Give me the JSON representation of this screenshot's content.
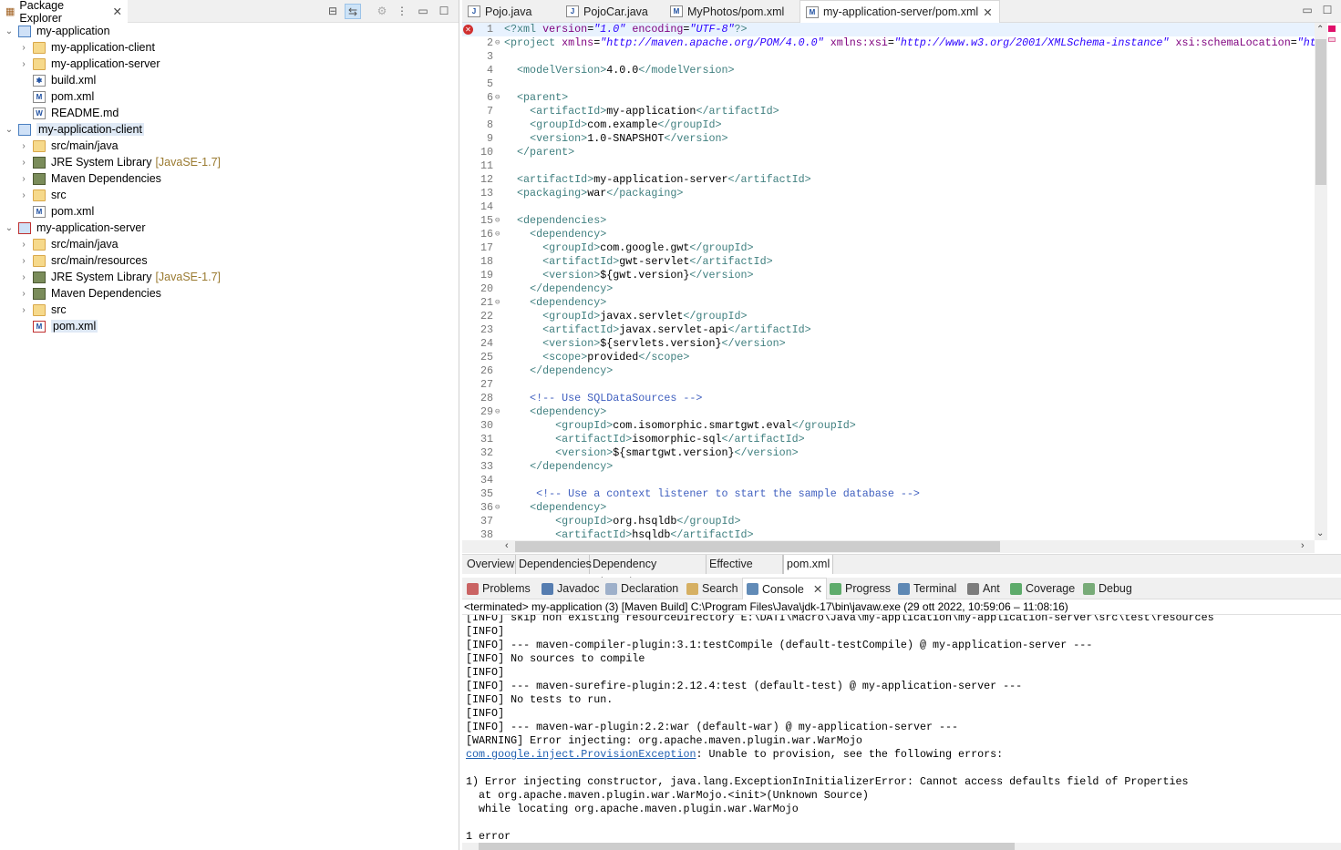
{
  "package_explorer": {
    "title": "Package Explorer",
    "tree": [
      {
        "level": 0,
        "expanded": true,
        "icon": "project",
        "label": "my-application"
      },
      {
        "level": 1,
        "expanded": false,
        "icon": "folder",
        "label": "my-application-client"
      },
      {
        "level": 1,
        "expanded": false,
        "icon": "folder",
        "label": "my-application-server"
      },
      {
        "level": 1,
        "icon": "ant-file",
        "label": "build.xml"
      },
      {
        "level": 1,
        "icon": "maven-file",
        "label": "pom.xml"
      },
      {
        "level": 1,
        "icon": "text-file",
        "label": "README.md"
      },
      {
        "level": 0,
        "expanded": true,
        "icon": "project",
        "label": "my-application-client",
        "selected": true
      },
      {
        "level": 1,
        "expanded": false,
        "icon": "package-folder",
        "label": "src/main/java"
      },
      {
        "level": 1,
        "expanded": false,
        "icon": "library",
        "label": "JRE System Library",
        "decoration": "[JavaSE-1.7]"
      },
      {
        "level": 1,
        "expanded": false,
        "icon": "library",
        "label": "Maven Dependencies"
      },
      {
        "level": 1,
        "expanded": false,
        "icon": "folder",
        "label": "src"
      },
      {
        "level": 1,
        "icon": "maven-file",
        "label": "pom.xml"
      },
      {
        "level": 0,
        "expanded": true,
        "icon": "project-error",
        "label": "my-application-server"
      },
      {
        "level": 1,
        "expanded": false,
        "icon": "package-folder",
        "label": "src/main/java"
      },
      {
        "level": 1,
        "expanded": false,
        "icon": "package-folder",
        "label": "src/main/resources"
      },
      {
        "level": 1,
        "expanded": false,
        "icon": "library",
        "label": "JRE System Library",
        "decoration": "[JavaSE-1.7]"
      },
      {
        "level": 1,
        "expanded": false,
        "icon": "library",
        "label": "Maven Dependencies"
      },
      {
        "level": 1,
        "expanded": false,
        "icon": "folder",
        "label": "src"
      },
      {
        "level": 1,
        "icon": "maven-file-error",
        "label": "pom.xml",
        "selected": true
      }
    ]
  },
  "editor": {
    "tabs": [
      {
        "label": "Pojo.java",
        "icon": "java-file"
      },
      {
        "label": "PojoCar.java",
        "icon": "java-file"
      },
      {
        "label": "MyPhotos/pom.xml",
        "icon": "maven-file"
      },
      {
        "label": "my-application-server/pom.xml",
        "icon": "maven-file",
        "active": true
      }
    ],
    "error_line": 1,
    "lines": [
      {
        "n": 1,
        "text": "<?xml version=\"1.0\" encoding=\"UTF-8\"?>"
      },
      {
        "n": 2,
        "fold": true,
        "text": "<project xmlns=\"http://maven.apache.org/POM/4.0.0\" xmlns:xsi=\"http://www.w3.org/2001/XMLSchema-instance\" xsi:schemaLocation=\"ht"
      },
      {
        "n": 3,
        "text": ""
      },
      {
        "n": 4,
        "text": "  <modelVersion>4.0.0</modelVersion>"
      },
      {
        "n": 5,
        "text": ""
      },
      {
        "n": 6,
        "fold": true,
        "text": "  <parent>"
      },
      {
        "n": 7,
        "text": "    <artifactId>my-application</artifactId>"
      },
      {
        "n": 8,
        "text": "    <groupId>com.example</groupId>"
      },
      {
        "n": 9,
        "text": "    <version>1.0-SNAPSHOT</version>"
      },
      {
        "n": 10,
        "text": "  </parent>"
      },
      {
        "n": 11,
        "text": ""
      },
      {
        "n": 12,
        "text": "  <artifactId>my-application-server</artifactId>"
      },
      {
        "n": 13,
        "text": "  <packaging>war</packaging>"
      },
      {
        "n": 14,
        "text": ""
      },
      {
        "n": 15,
        "fold": true,
        "text": "  <dependencies>"
      },
      {
        "n": 16,
        "fold": true,
        "text": "    <dependency>"
      },
      {
        "n": 17,
        "text": "      <groupId>com.google.gwt</groupId>"
      },
      {
        "n": 18,
        "text": "      <artifactId>gwt-servlet</artifactId>"
      },
      {
        "n": 19,
        "text": "      <version>${gwt.version}</version>"
      },
      {
        "n": 20,
        "text": "    </dependency>"
      },
      {
        "n": 21,
        "fold": true,
        "text": "    <dependency>"
      },
      {
        "n": 22,
        "text": "      <groupId>javax.servlet</groupId>"
      },
      {
        "n": 23,
        "text": "      <artifactId>javax.servlet-api</artifactId>"
      },
      {
        "n": 24,
        "text": "      <version>${servlets.version}</version>"
      },
      {
        "n": 25,
        "text": "      <scope>provided</scope>"
      },
      {
        "n": 26,
        "text": "    </dependency>"
      },
      {
        "n": 27,
        "text": ""
      },
      {
        "n": 28,
        "text": "    <!-- Use SQLDataSources -->"
      },
      {
        "n": 29,
        "fold": true,
        "text": "    <dependency>"
      },
      {
        "n": 30,
        "text": "        <groupId>com.isomorphic.smartgwt.eval</groupId>"
      },
      {
        "n": 31,
        "text": "        <artifactId>isomorphic-sql</artifactId>"
      },
      {
        "n": 32,
        "text": "        <version>${smartgwt.version}</version>"
      },
      {
        "n": 33,
        "text": "    </dependency>"
      },
      {
        "n": 34,
        "text": ""
      },
      {
        "n": 35,
        "text": "     <!-- Use a context listener to start the sample database -->"
      },
      {
        "n": 36,
        "fold": true,
        "text": "    <dependency>"
      },
      {
        "n": 37,
        "text": "        <groupId>org.hsqldb</groupId>"
      },
      {
        "n": 38,
        "text": "        <artifactId>hsqldb</artifactId>"
      }
    ],
    "pom_tabs": [
      "Overview",
      "Dependencies",
      "Dependency Hierarchy",
      "Effective POM",
      "pom.xml"
    ],
    "active_pom_tab": "pom.xml"
  },
  "console": {
    "tabs": [
      {
        "label": "Problems",
        "icon": "problems-icon",
        "color": "#c04040"
      },
      {
        "label": "Javadoc",
        "icon": "at-icon",
        "color": "#3060a0"
      },
      {
        "label": "Declaration",
        "icon": "declaration-icon",
        "color": "#8aa0c0"
      },
      {
        "label": "Search",
        "icon": "search-icon",
        "color": "#d0a040"
      },
      {
        "label": "Console",
        "icon": "console-icon",
        "color": "#3a6ea5",
        "active": true
      },
      {
        "label": "Progress",
        "icon": "progress-icon",
        "color": "#3a9a4a"
      },
      {
        "label": "Terminal",
        "icon": "terminal-icon",
        "color": "#3a6ea5"
      },
      {
        "label": "Ant",
        "icon": "ant-icon",
        "color": "#606060"
      },
      {
        "label": "Coverage",
        "icon": "coverage-icon",
        "color": "#3a9a4a"
      },
      {
        "label": "Debug",
        "icon": "debug-icon",
        "color": "#5a9a5a"
      }
    ],
    "status": "<terminated> my-application (3) [Maven Build] C:\\Program Files\\Java\\jdk-17\\bin\\javaw.exe  (29 ott 2022, 10:59:06 – 11:08:16)",
    "lines": [
      {
        "text": "[INFO] skip non existing resourceDirectory E:\\DATI\\Macro\\Java\\my-application\\my-application-server\\src\\test\\resources"
      },
      {
        "text": "[INFO]"
      },
      {
        "text": "[INFO] --- maven-compiler-plugin:3.1:testCompile (default-testCompile) @ my-application-server ---"
      },
      {
        "text": "[INFO] No sources to compile"
      },
      {
        "text": "[INFO]"
      },
      {
        "text": "[INFO] --- maven-surefire-plugin:2.12.4:test (default-test) @ my-application-server ---"
      },
      {
        "text": "[INFO] No tests to run."
      },
      {
        "text": "[INFO]"
      },
      {
        "text": "[INFO] --- maven-war-plugin:2.2:war (default-war) @ my-application-server ---"
      },
      {
        "text": "[WARNING] Error injecting: org.apache.maven.plugin.war.WarMojo"
      },
      {
        "link": "com.google.inject.ProvisionException",
        "text": ": Unable to provision, see the following errors:"
      },
      {
        "text": ""
      },
      {
        "text": "1) Error injecting constructor, java.lang.ExceptionInInitializerError: Cannot access defaults field of Properties"
      },
      {
        "text": "  at org.apache.maven.plugin.war.WarMojo.<init>(Unknown Source)"
      },
      {
        "text": "  while locating org.apache.maven.plugin.war.WarMojo"
      },
      {
        "text": ""
      },
      {
        "text": "1 error"
      }
    ]
  }
}
